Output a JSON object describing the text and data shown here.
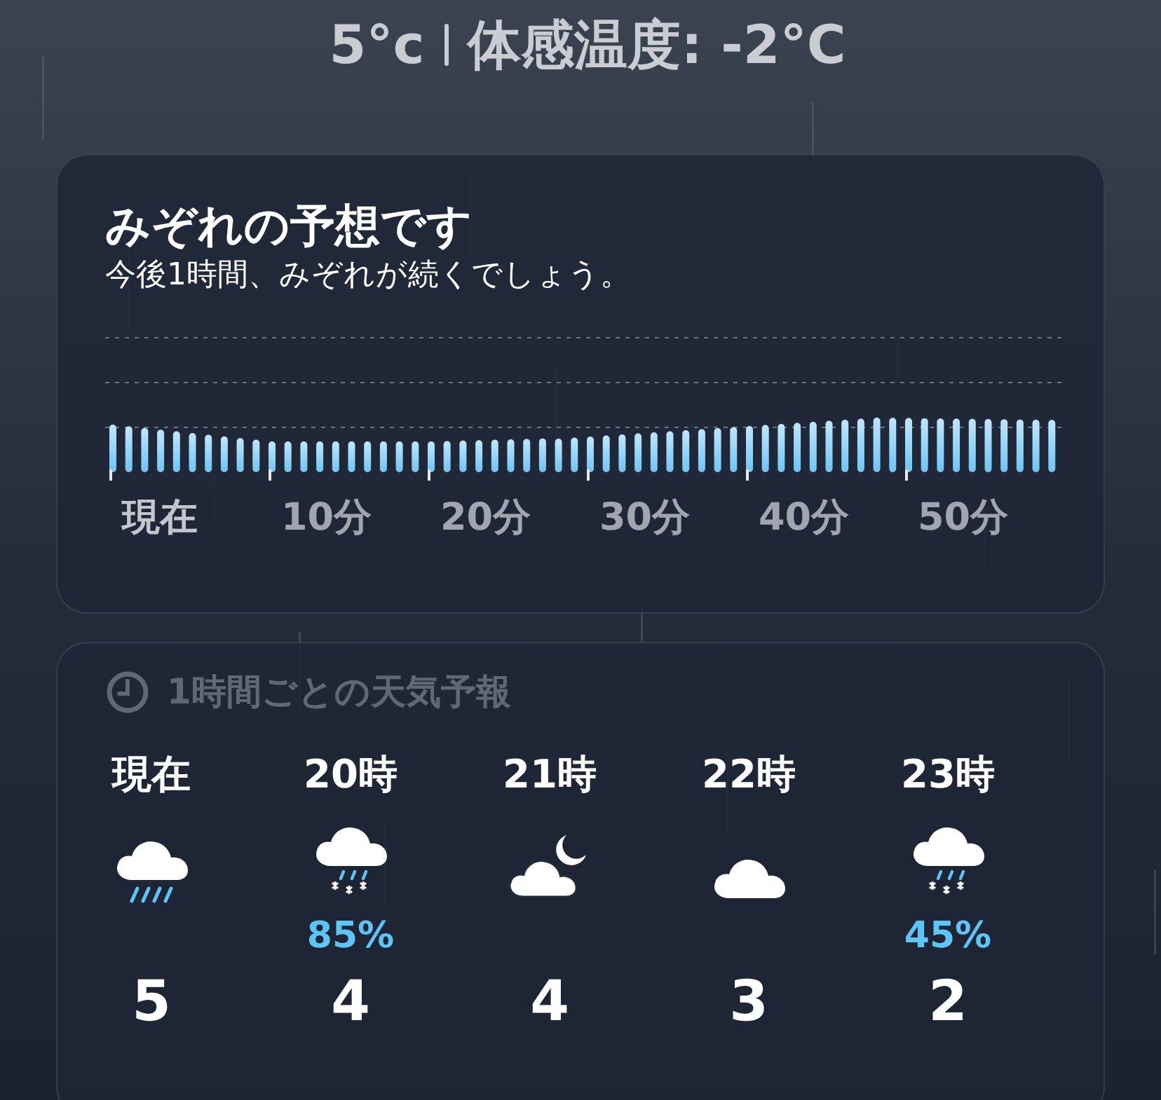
{
  "current": {
    "temperature": "5°c",
    "feels_like": "体感温度: -2°C"
  },
  "precipitation": {
    "title": "みぞれの予想です",
    "summary": "今後1時間、みぞれが続くでしょう。",
    "axis_labels": [
      "現在",
      "10分",
      "20分",
      "30分",
      "40分",
      "50分"
    ]
  },
  "hourly": {
    "title": "1時間ごとの天気予報",
    "hours": [
      {
        "time": "現在",
        "kind": "rain",
        "temperature": "5"
      },
      {
        "time": "20時",
        "kind": "sleet",
        "chance": "85%",
        "temperature": "4"
      },
      {
        "time": "21時",
        "kind": "moon-cloud",
        "temperature": "4"
      },
      {
        "time": "22時",
        "kind": "cloud",
        "temperature": "3"
      },
      {
        "time": "23時",
        "kind": "sleet",
        "chance": "45%",
        "temperature": "2"
      }
    ]
  }
}
